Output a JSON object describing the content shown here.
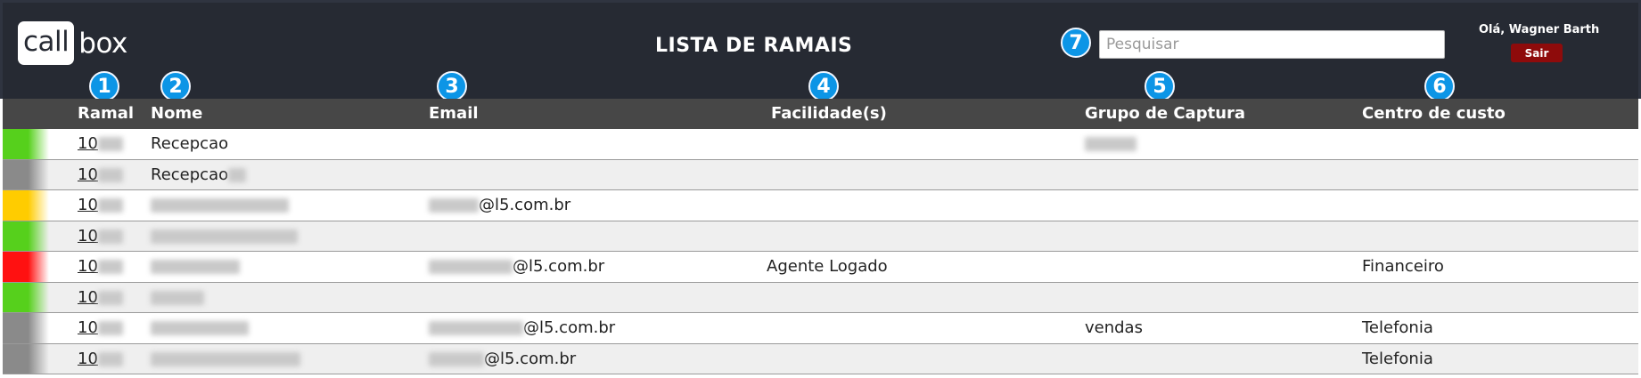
{
  "brand": {
    "part1": "call",
    "part2": "box"
  },
  "title": "LISTA DE RAMAIS",
  "search": {
    "placeholder": "Pesquisar",
    "value": ""
  },
  "user": {
    "greeting": "Olá, Wagner Barth",
    "logout_label": "Sair"
  },
  "badges": [
    "1",
    "2",
    "3",
    "4",
    "5",
    "6",
    "7"
  ],
  "columns": [
    "Ramal",
    "Nome",
    "Email",
    "Facilidade(s)",
    "Grupo de Captura",
    "Centro de custo"
  ],
  "status_colors": {
    "green": "#56d01c",
    "yellow": "#ffcc00",
    "red": "#ff1111",
    "gray": "#8a8a8a"
  },
  "rows": [
    {
      "status": "green",
      "ramal": "10",
      "nome": "Recepcao",
      "email": "",
      "facilidade": "",
      "grupo": "",
      "centro": ""
    },
    {
      "status": "gray",
      "ramal": "10",
      "nome": "Recepcao",
      "email": "",
      "facilidade": "",
      "grupo": "",
      "centro": ""
    },
    {
      "status": "yellow",
      "ramal": "10",
      "nome": "",
      "email": "@l5.com.br",
      "facilidade": "",
      "grupo": "",
      "centro": ""
    },
    {
      "status": "green",
      "ramal": "10",
      "nome": "",
      "email": "",
      "facilidade": "",
      "grupo": "",
      "centro": ""
    },
    {
      "status": "red",
      "ramal": "10",
      "nome": "",
      "email": "@l5.com.br",
      "facilidade": "Agente Logado",
      "grupo": "",
      "centro": "Financeiro"
    },
    {
      "status": "green",
      "ramal": "10",
      "nome": "",
      "email": "",
      "facilidade": "",
      "grupo": "",
      "centro": ""
    },
    {
      "status": "gray",
      "ramal": "10",
      "nome": "",
      "email": "@l5.com.br",
      "facilidade": "",
      "grupo": "vendas",
      "centro": "Telefonia"
    },
    {
      "status": "gray",
      "ramal": "10",
      "nome": "",
      "email": "@l5.com.br",
      "facilidade": "",
      "grupo": "",
      "centro": "Telefonia"
    }
  ]
}
